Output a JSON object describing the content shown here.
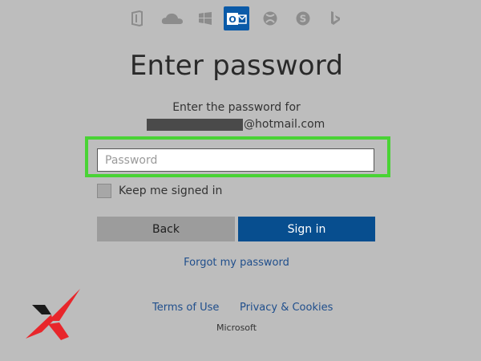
{
  "header": {
    "apps": [
      {
        "name": "office-icon",
        "active": false
      },
      {
        "name": "onedrive-icon",
        "active": false
      },
      {
        "name": "windows-icon",
        "active": false
      },
      {
        "name": "outlook-icon",
        "active": true
      },
      {
        "name": "xbox-icon",
        "active": false
      },
      {
        "name": "skype-icon",
        "active": false
      },
      {
        "name": "bing-icon",
        "active": false
      }
    ]
  },
  "main": {
    "title": "Enter password",
    "subtitle": "Enter the password for",
    "email_domain": "@hotmail.com",
    "password_placeholder": "Password",
    "password_value": "",
    "keep_signed_in_label": "Keep me signed in",
    "keep_signed_in_checked": false,
    "back_label": "Back",
    "signin_label": "Sign in",
    "forgot_label": "Forgot my password"
  },
  "footer": {
    "terms_label": "Terms of Use",
    "privacy_label": "Privacy & Cookies",
    "company_label": "Microsoft"
  },
  "colors": {
    "background": "#bdbdbd",
    "signin_button": "#074e8f",
    "back_button": "#9c9c9c",
    "link": "#1f4e8c",
    "highlight": "#49d335",
    "logo_red": "#e8262b"
  }
}
